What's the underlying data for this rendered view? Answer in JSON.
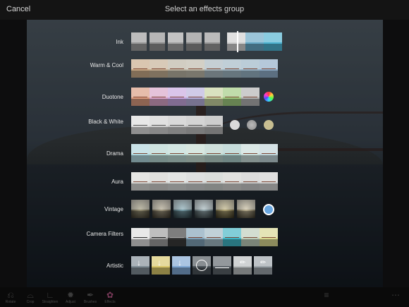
{
  "header": {
    "cancel_label": "Cancel",
    "title": "Select an effects group"
  },
  "groups": [
    {
      "label": "Ink",
      "thumbs": 4,
      "extra": "ink-strip"
    },
    {
      "label": "Warm & Cool",
      "thumbs": 8
    },
    {
      "label": "Duotone",
      "thumbs": 7,
      "extra": "color-wheel"
    },
    {
      "label": "Black & White",
      "thumbs": 5,
      "extra": "tone-circles"
    },
    {
      "label": "Drama",
      "thumbs": 8
    },
    {
      "label": "Aura",
      "thumbs": 8
    },
    {
      "label": "Vintage",
      "thumbs": 6,
      "extra": "blue-circle"
    },
    {
      "label": "Camera Filters",
      "thumbs": 8
    },
    {
      "label": "Artistic",
      "thumbs": 7
    }
  ],
  "toolbar": {
    "items": [
      "Rotate",
      "Crop",
      "Straighten",
      "Adjust",
      "Brushes",
      "Effects"
    ]
  },
  "colors": {
    "background": "#0d0d0e",
    "bar": "#141414",
    "label_text": "#e8e8e8",
    "vintage_circle": "#6aa7e0"
  }
}
